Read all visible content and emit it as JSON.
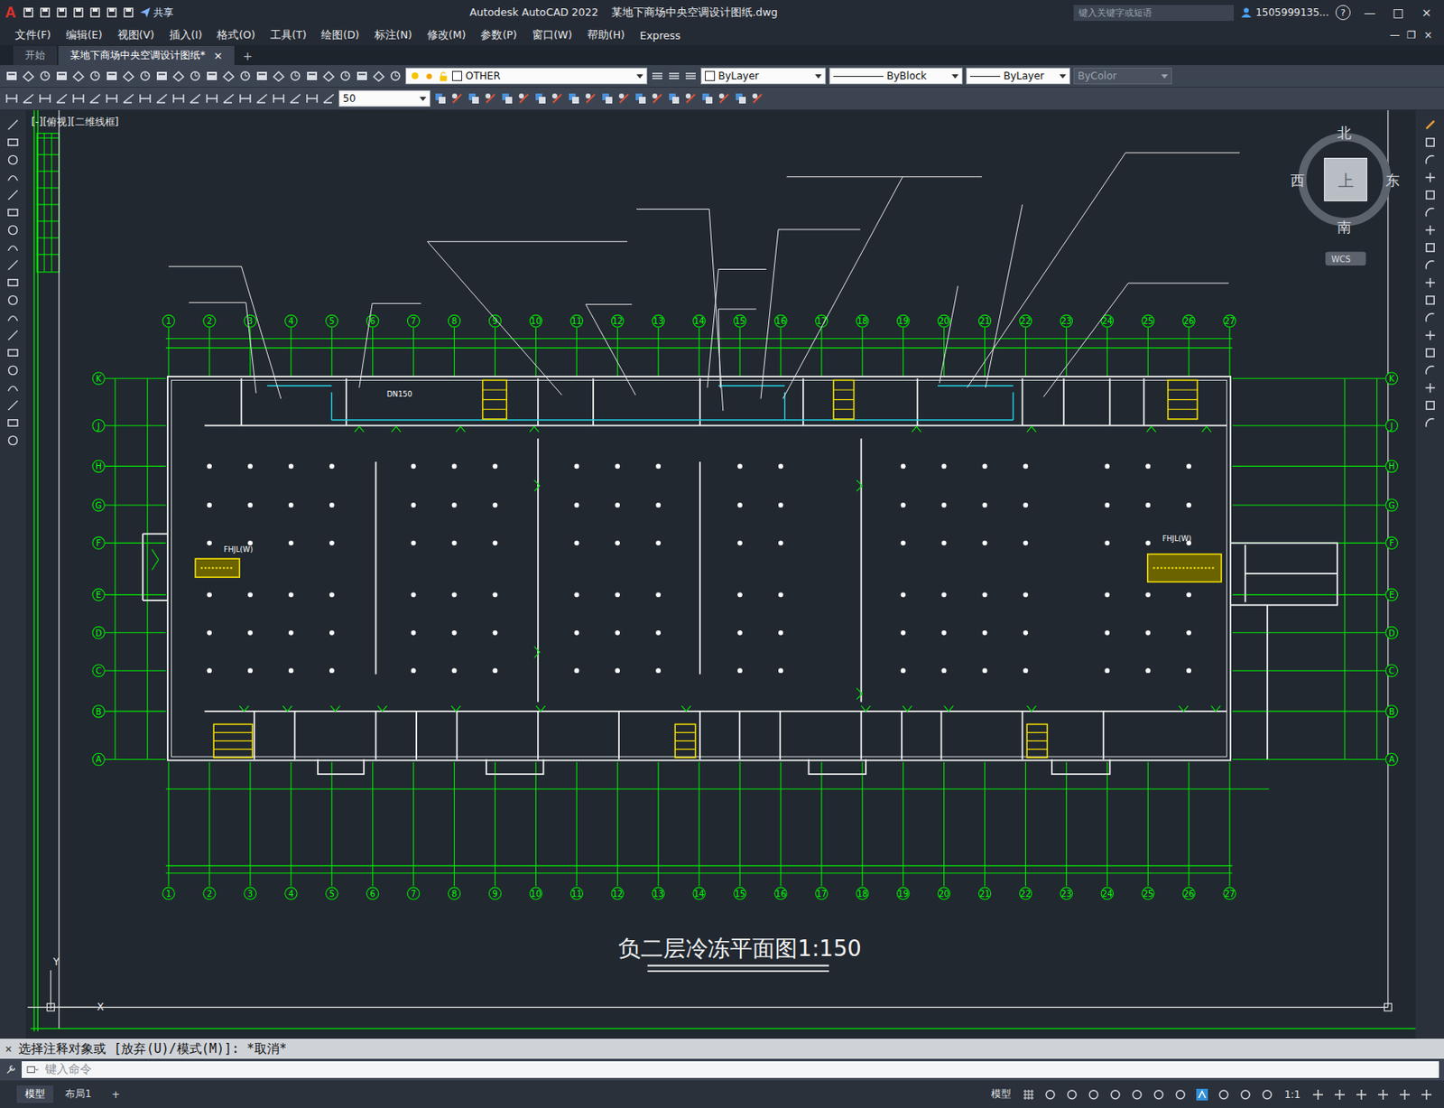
{
  "window": {
    "logo": "A",
    "app_name": "Autodesk AutoCAD 2022",
    "file": "某地下商场中央空调设计图纸.dwg",
    "share": "共享",
    "search_placeholder": "键入关键字或短语",
    "user": "1505999135...",
    "help": "?",
    "controls": [
      "—",
      "□",
      "×"
    ]
  },
  "menu": {
    "items": [
      "文件(F)",
      "编辑(E)",
      "视图(V)",
      "插入(I)",
      "格式(O)",
      "工具(T)",
      "绘图(D)",
      "标注(N)",
      "修改(M)",
      "参数(P)",
      "窗口(W)",
      "帮助(H)",
      "Express"
    ],
    "doc_controls": [
      "—",
      "❐",
      "×"
    ]
  },
  "doc_tabs": [
    {
      "label": "开始",
      "selected": false,
      "closable": false
    },
    {
      "label": "某地下商场中央空调设计图纸*",
      "selected": true,
      "closable": true
    }
  ],
  "new_tab": "+",
  "tab_close": "×",
  "toolbar": {
    "layer": "OTHER",
    "color": "ByLayer",
    "linetype": "ByBlock",
    "lineweight": "ByLayer",
    "plotstyle": {
      "text": "ByColor",
      "disabled": true
    },
    "scale": "50"
  },
  "viewport_label": "[-][俯视][二维线框]",
  "viewcube": {
    "north": "北",
    "south": "南",
    "west": "西",
    "east": "东",
    "top": "上",
    "wcs": "WCS"
  },
  "drawing": {
    "title": "负二层冷冻平面图1:150",
    "columns": [
      "1",
      "2",
      "3",
      "4",
      "5",
      "6",
      "7",
      "8",
      "9",
      "10",
      "11",
      "12",
      "13",
      "14",
      "15",
      "16",
      "17",
      "18",
      "19",
      "20",
      "21",
      "22",
      "23",
      "24",
      "25",
      "26",
      "27"
    ],
    "rows": [
      "K",
      "J",
      "H",
      "G",
      "F",
      "E",
      "D",
      "C",
      "B",
      "A"
    ],
    "annotations": [
      "DN150",
      "FHJL(W)",
      "FHJL(W)"
    ],
    "ucs": [
      "Y",
      "X"
    ]
  },
  "command": {
    "close": "×",
    "history": "选择注释对象或 [放弃(U)/模式(M)]: *取消*",
    "placeholder": "键入命令"
  },
  "status_bar": {
    "layouts": [
      {
        "label": "模型",
        "selected": true
      },
      {
        "label": "布局1",
        "selected": false
      }
    ],
    "add": "+",
    "right": [
      "模型",
      "1:1"
    ]
  }
}
